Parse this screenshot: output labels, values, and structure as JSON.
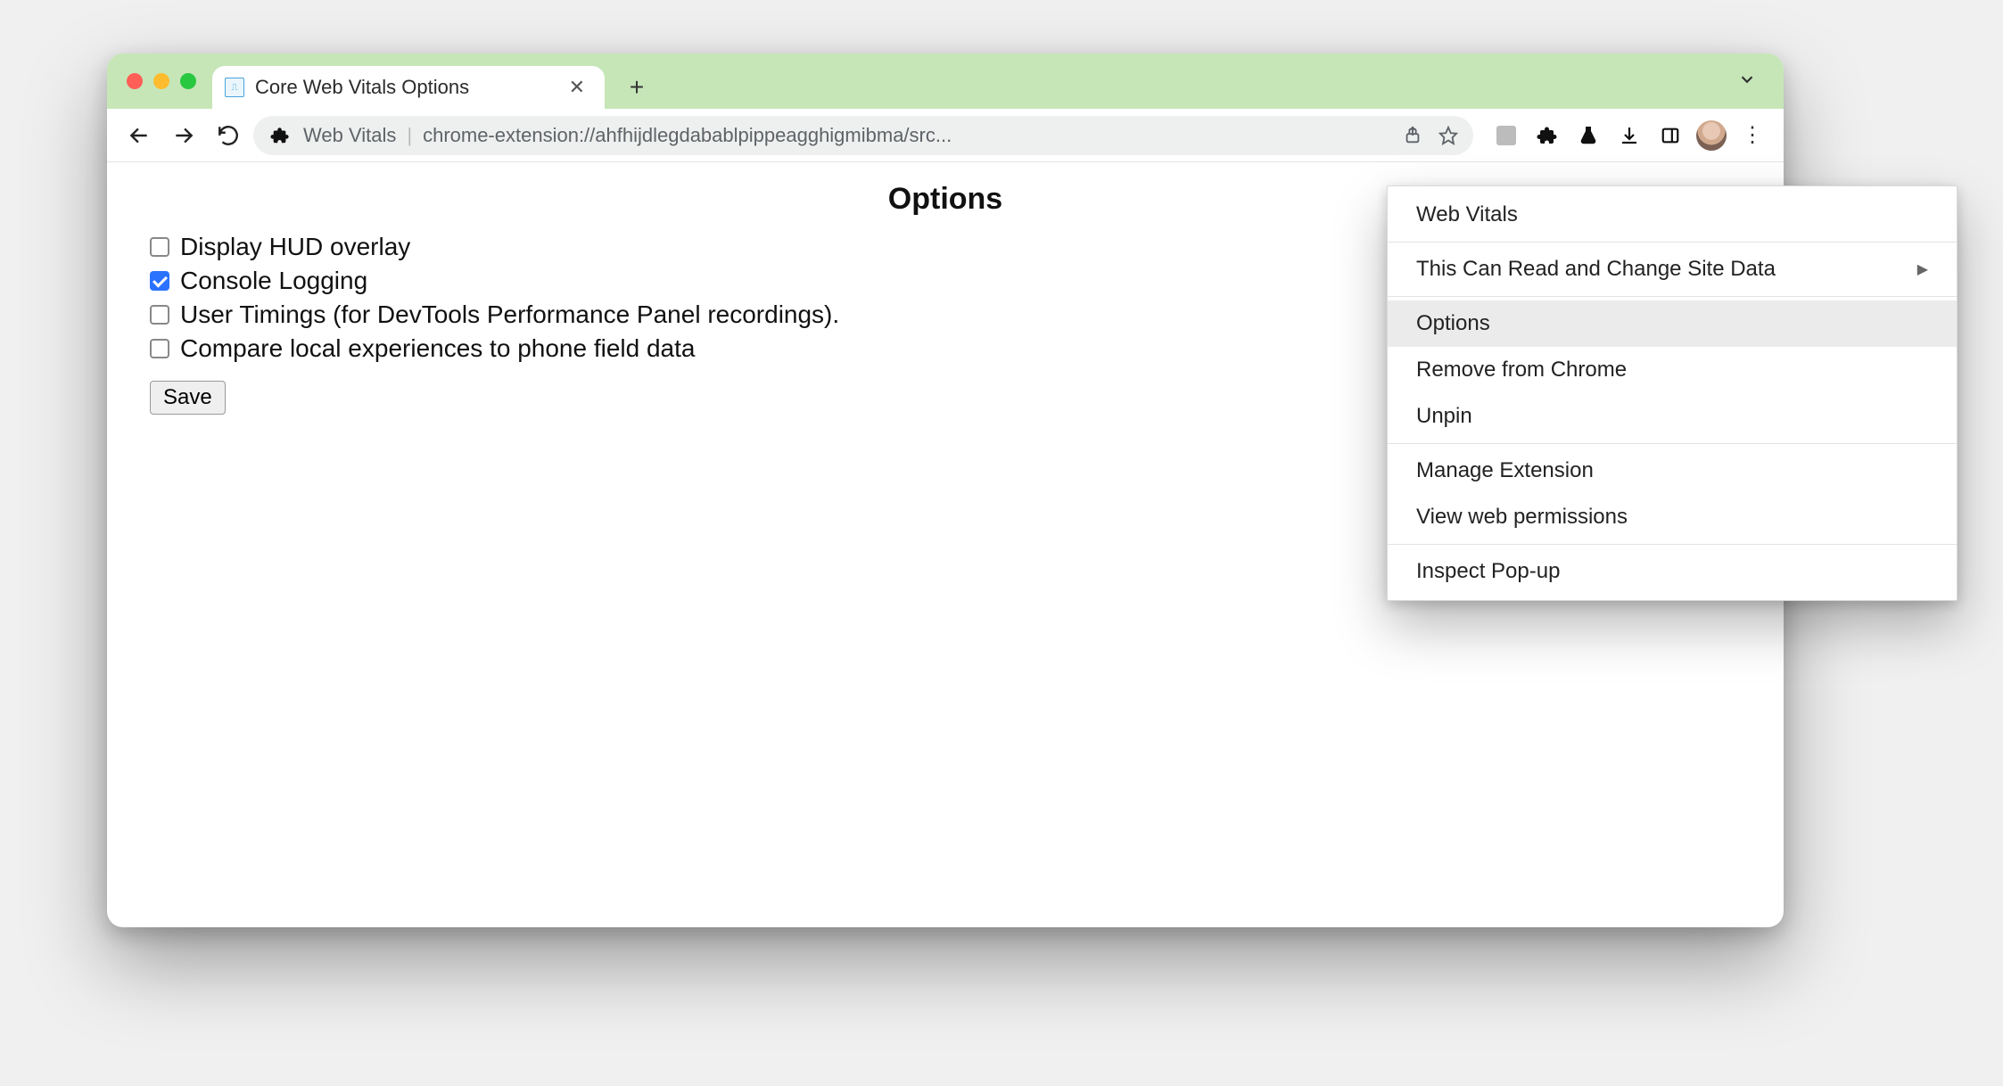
{
  "tab": {
    "title": "Core Web Vitals Options"
  },
  "omnibox": {
    "ext_label": "Web Vitals",
    "url": "chrome-extension://ahfhijdlegdabablpippeagghigmibma/src..."
  },
  "page": {
    "heading": "Options",
    "options": [
      {
        "label": "Display HUD overlay",
        "checked": false
      },
      {
        "label": "Console Logging",
        "checked": true
      },
      {
        "label": "User Timings (for DevTools Performance Panel recordings).",
        "checked": false
      },
      {
        "label": "Compare local experiences to phone field data",
        "checked": false
      }
    ],
    "save_label": "Save"
  },
  "context_menu": {
    "title": "Web Vitals",
    "read_change": "This Can Read and Change Site Data",
    "options": "Options",
    "remove": "Remove from Chrome",
    "unpin": "Unpin",
    "manage": "Manage Extension",
    "view_perms": "View web permissions",
    "inspect": "Inspect Pop-up"
  }
}
